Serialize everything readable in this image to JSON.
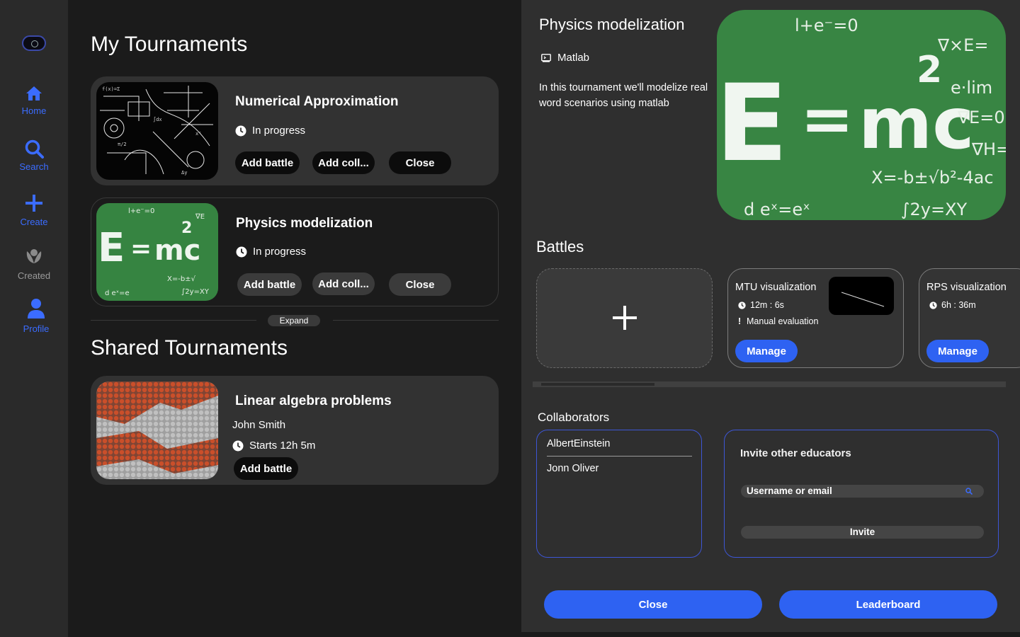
{
  "sidebar": {
    "items": [
      {
        "label": "Home",
        "icon": "home-icon"
      },
      {
        "label": "Search",
        "icon": "search-icon"
      },
      {
        "label": "Create",
        "icon": "plus-icon"
      },
      {
        "label": "Created",
        "icon": "laurel-icon"
      },
      {
        "label": "Profile",
        "icon": "user-icon"
      }
    ]
  },
  "my_tournaments": {
    "title": "My Tournaments",
    "cards": [
      {
        "name": "Numerical Approximation",
        "status": "In progress",
        "add_battle": "Add battle",
        "add_collab": "Add coll...",
        "close": "Close"
      },
      {
        "name": "Physics modelization",
        "status": "In progress",
        "add_battle": "Add battle",
        "add_collab": "Add coll...",
        "close": "Close"
      }
    ],
    "expand": "Expand"
  },
  "shared_tournaments": {
    "title": "Shared Tournaments",
    "cards": [
      {
        "name": "Linear algebra problems",
        "owner": "John Smith",
        "status": "Starts 12h 5m",
        "add_battle": "Add battle"
      }
    ]
  },
  "detail": {
    "title": "Physics modelization",
    "language": "Matlab",
    "description": "In this tournament we'll modelize real word scenarios using matlab",
    "battles_title": "Battles",
    "battles": [
      {
        "name": "MTU visualization",
        "time": "12m : 6s",
        "evaluation": "Manual evaluation",
        "manage": "Manage"
      },
      {
        "name": "RPS visualization",
        "time": "6h : 36m",
        "manage": "Manage"
      }
    ],
    "collaborators_title": "Collaborators",
    "collaborators": [
      "AlbertEinstein",
      "Jonn Oliver"
    ],
    "invite": {
      "title": "Invite other educators",
      "placeholder": "Username or email",
      "button": "Invite"
    },
    "close": "Close",
    "leaderboard": "Leaderboard"
  },
  "colors": {
    "accent": "#2e62f2",
    "sidebar_bg": "#2a2a2a",
    "panel_bg": "#2f2f2f",
    "card_bg": "#323232"
  }
}
